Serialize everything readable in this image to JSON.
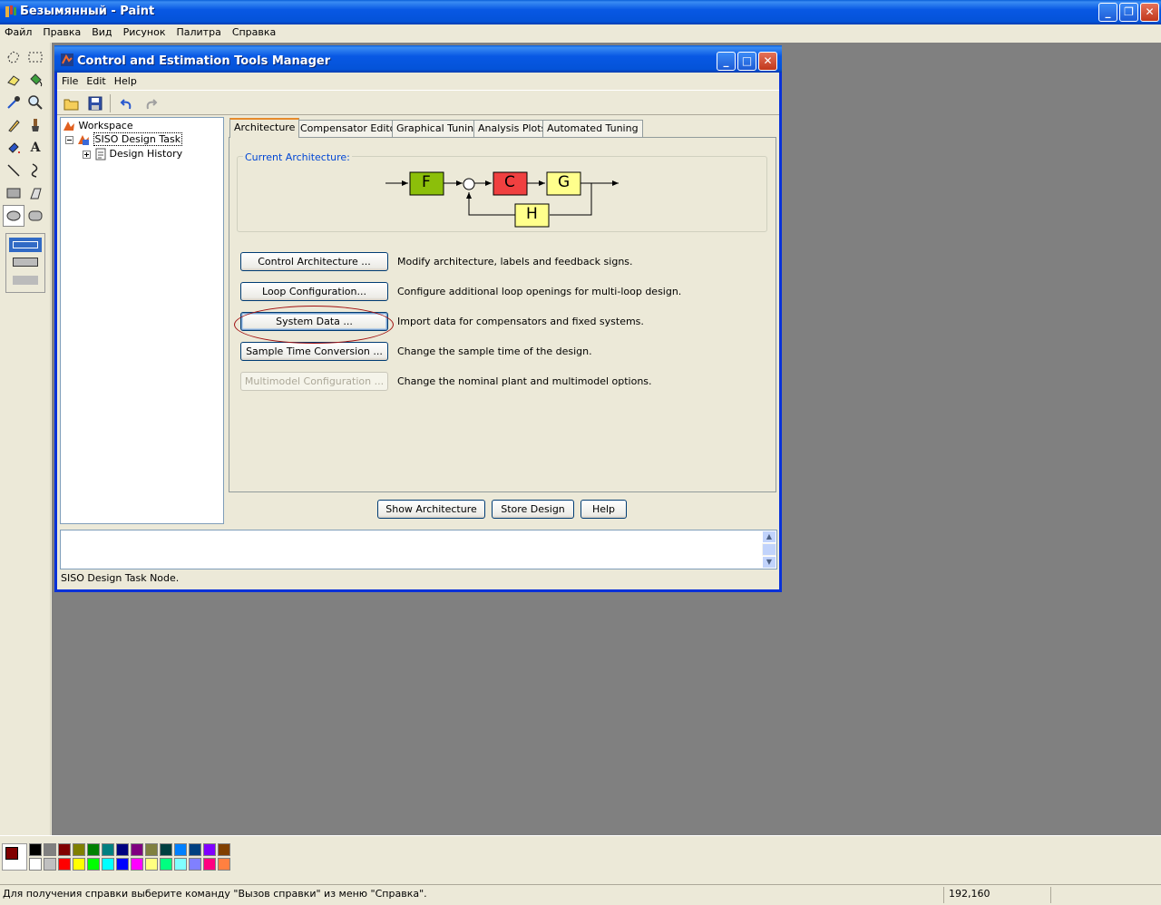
{
  "paint": {
    "title": "Безымянный - Paint",
    "menu": [
      "Файл",
      "Правка",
      "Вид",
      "Рисунок",
      "Палитра",
      "Справка"
    ],
    "status_message": "Для получения справки выберите команду \"Вызов справки\" из меню \"Справка\".",
    "coordinates": "192,160",
    "palette_top": [
      "#000000",
      "#808080",
      "#800000",
      "#808000",
      "#008000",
      "#008080",
      "#000080",
      "#800080",
      "#808040",
      "#004040",
      "#0080FF",
      "#004080",
      "#8000FF",
      "#804000"
    ],
    "palette_bottom": [
      "#FFFFFF",
      "#C0C0C0",
      "#FF0000",
      "#FFFF00",
      "#00FF00",
      "#00FFFF",
      "#0000FF",
      "#FF00FF",
      "#FFFF80",
      "#00FF80",
      "#80FFFF",
      "#8080FF",
      "#FF0080",
      "#FF8040"
    ],
    "foreground_color": "#800000",
    "background_color": "#FFFFFF"
  },
  "ctm": {
    "title": "Control and Estimation Tools Manager",
    "menu": [
      "File",
      "Edit",
      "Help"
    ],
    "tree": {
      "root": "Workspace",
      "task": "SISO Design Task",
      "child": "Design History"
    },
    "tabs": [
      "Architecture",
      "Compensator Editor",
      "Graphical Tuning",
      "Analysis Plots",
      "Automated Tuning"
    ],
    "current_architecture_label": "Current Architecture:",
    "blocks": {
      "f": "F",
      "c": "C",
      "g": "G",
      "h": "H"
    },
    "actions": [
      {
        "label": "Control Architecture ...",
        "desc": "Modify architecture, labels and feedback signs."
      },
      {
        "label": "Loop Configuration...",
        "desc": "Configure additional loop openings for multi-loop design."
      },
      {
        "label": "System Data ...",
        "desc": "Import data for compensators and fixed systems."
      },
      {
        "label": "Sample Time Conversion ...",
        "desc": "Change the sample time of the design."
      },
      {
        "label": "Multimodel Configuration ...",
        "desc": "Change the nominal plant and multimodel options."
      }
    ],
    "bottom_buttons": {
      "show": "Show Architecture",
      "store": "Store Design",
      "help": "Help"
    },
    "status": "SISO Design Task Node."
  }
}
